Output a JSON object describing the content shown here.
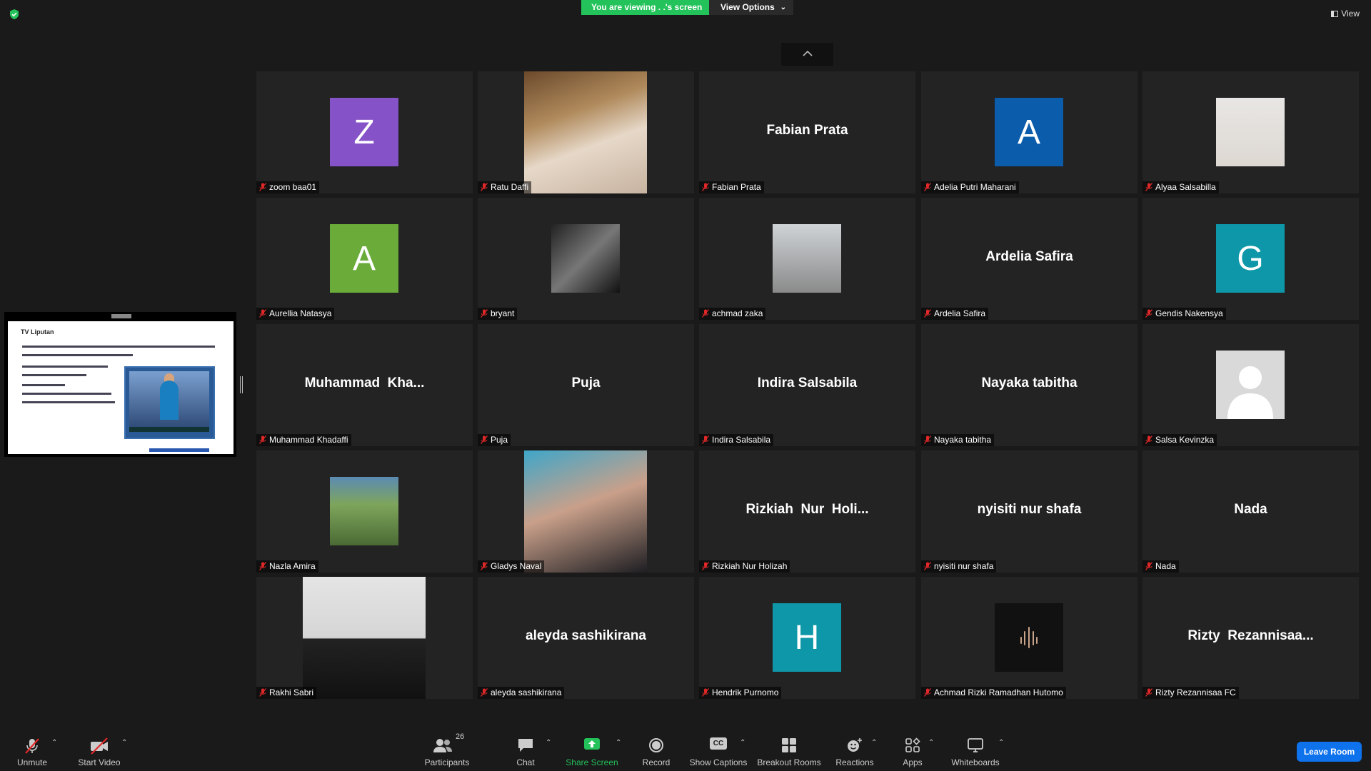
{
  "top": {
    "viewing_text": "You are viewing . .'s screen",
    "view_options_label": "View Options",
    "view_label": "View"
  },
  "colors": {
    "viewing_green": "#23c25a",
    "leave_blue": "#0e72ed",
    "mute_red": "#e02828"
  },
  "participants": [
    {
      "label": "zoom baa01",
      "display": "avatar",
      "letter": "Z",
      "color": "#8652c8"
    },
    {
      "label": "Ratu Daffi",
      "display": "photo"
    },
    {
      "label": "Fabian Prata",
      "display": "name",
      "name": "Fabian Prata"
    },
    {
      "label": "Adelia Putri Maharani",
      "display": "avatar",
      "letter": "A",
      "color": "#0b5cab"
    },
    {
      "label": "Alyaa Salsabilla",
      "display": "photo"
    },
    {
      "label": "Aurellia Natasya",
      "display": "avatar",
      "letter": "A",
      "color": "#6aab3a"
    },
    {
      "label": "bryant",
      "display": "photo"
    },
    {
      "label": "achmad zaka",
      "display": "photo"
    },
    {
      "label": "Ardelia Safira",
      "display": "name",
      "name": "Ardelia Safira"
    },
    {
      "label": "Gendis Nakensya",
      "display": "avatar",
      "letter": "G",
      "color": "#0e97a8"
    },
    {
      "label": "Muhammad Khadaffi",
      "display": "name",
      "name": "Muhammad  Kha..."
    },
    {
      "label": "Puja",
      "display": "name",
      "name": "Puja"
    },
    {
      "label": "Indira Salsabila",
      "display": "name",
      "name": "Indira Salsabila"
    },
    {
      "label": "Nayaka tabitha",
      "display": "name",
      "name": "Nayaka tabitha"
    },
    {
      "label": "Salsa Kevinzka",
      "display": "default-avatar"
    },
    {
      "label": "Nazla Amira",
      "display": "photo"
    },
    {
      "label": "Gladys Naval",
      "display": "photo"
    },
    {
      "label": "Rizkiah Nur Holizah",
      "display": "name",
      "name": "Rizkiah  Nur  Holi..."
    },
    {
      "label": "nyisiti nur shafa",
      "display": "name",
      "name": "nyisiti nur shafa"
    },
    {
      "label": "Nada",
      "display": "name",
      "name": "Nada"
    },
    {
      "label": "Rakhi Sabri",
      "display": "photo"
    },
    {
      "label": "aleyda sashikirana",
      "display": "name",
      "name": "aleyda sashikirana"
    },
    {
      "label": "Hendrik Purnomo",
      "display": "avatar",
      "letter": "H",
      "color": "#0e97a8"
    },
    {
      "label": "Achmad Rizki Ramadhan Hutomo",
      "display": "logo"
    },
    {
      "label": "Rizty Rezannisaa FC",
      "display": "name",
      "name": "Rizty  Rezannisaa..."
    }
  ],
  "shared_slide": {
    "title": "TV Liputan"
  },
  "toolbar": {
    "unmute": "Unmute",
    "start_video": "Start Video",
    "participants": "Participants",
    "participants_count": "26",
    "chat": "Chat",
    "share_screen": "Share Screen",
    "record": "Record",
    "show_captions": "Show Captions",
    "captions_badge": "CC",
    "breakout_rooms": "Breakout Rooms",
    "reactions": "Reactions",
    "apps": "Apps",
    "whiteboards": "Whiteboards",
    "leave_room": "Leave Room"
  }
}
